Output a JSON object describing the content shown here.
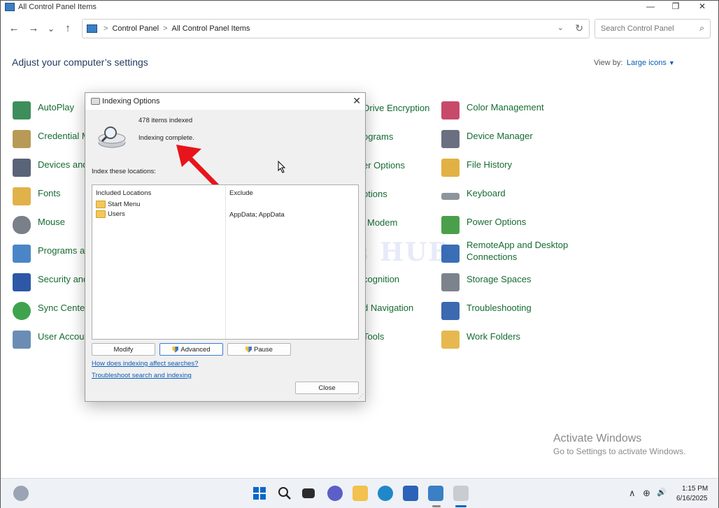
{
  "window": {
    "title": "All Control Panel Items",
    "minimize": "—",
    "maximize": "❐",
    "close": "✕"
  },
  "nav": {
    "back": "←",
    "forward": "→",
    "recent": "⌄",
    "up": "↑",
    "breadcrumb": [
      "Control Panel",
      "All Control Panel Items"
    ],
    "sep": ">",
    "dropdown": "⌄",
    "refresh": "↻",
    "search_placeholder": "Search Control Panel",
    "search_icon": "⌕"
  },
  "header": {
    "title": "Adjust your computer’s settings",
    "view_by_label": "View by:",
    "view_by_value": "Large icons",
    "view_by_caret": "▼"
  },
  "items": {
    "col1": [
      {
        "label": "AutoPlay",
        "icon": "autoplay-icon",
        "color": "#3e8e5c"
      },
      {
        "label": "Credential M",
        "icon": "credential-manager-icon",
        "color": "#b89a57"
      },
      {
        "label": "Devices and",
        "icon": "devices-printers-icon",
        "color": "#5a6478"
      },
      {
        "label": "Fonts",
        "icon": "fonts-icon",
        "color": "#e1b24a"
      },
      {
        "label": "Mouse",
        "icon": "mouse-icon",
        "color": "#7a8089"
      },
      {
        "label": "Programs an",
        "icon": "programs-features-icon",
        "color": "#4a86c7"
      },
      {
        "label": "Security and",
        "icon": "security-maintenance-icon",
        "color": "#2c58a6"
      },
      {
        "label": "Sync Center",
        "icon": "sync-center-icon",
        "color": "#3fa34d"
      },
      {
        "label": "User Accour",
        "icon": "user-accounts-icon",
        "color": "#6b8db5"
      }
    ],
    "col2": [
      {
        "label": "Drive Encryption",
        "icon": "",
        "color": ""
      },
      {
        "label": "ograms",
        "icon": "",
        "color": ""
      },
      {
        "label": "er Options",
        "icon": "",
        "color": ""
      },
      {
        "label": "ptions",
        "icon": "",
        "color": ""
      },
      {
        "label": "Modem",
        "icon": "",
        "color": ""
      },
      {
        "label": "",
        "icon": "",
        "color": ""
      },
      {
        "label": "cognition",
        "icon": "",
        "color": ""
      },
      {
        "label": "d Navigation",
        "icon": "",
        "color": ""
      },
      {
        "label": "Tools",
        "icon": "",
        "color": ""
      }
    ],
    "col3": [
      {
        "label": "Color Management",
        "icon": "color-management-icon",
        "color": "#c84a6a"
      },
      {
        "label": "Device Manager",
        "icon": "device-manager-icon",
        "color": "#6a7080"
      },
      {
        "label": "File History",
        "icon": "file-history-icon",
        "color": "#e2b143"
      },
      {
        "label": "Keyboard",
        "icon": "keyboard-icon",
        "color": "#8e949c"
      },
      {
        "label": "Power Options",
        "icon": "power-options-icon",
        "color": "#4aa04a"
      },
      {
        "label": "RemoteApp and Desktop Connections",
        "label2": "Connections",
        "label1": "RemoteApp and Desktop",
        "icon": "remoteapp-icon",
        "color": "#3a6fb5"
      },
      {
        "label": "Storage Spaces",
        "icon": "storage-spaces-icon",
        "color": "#7d838c"
      },
      {
        "label": "Troubleshooting",
        "icon": "troubleshooting-icon",
        "color": "#3c69b0"
      },
      {
        "label": "Work Folders",
        "icon": "work-folders-icon",
        "color": "#e6b84f"
      }
    ]
  },
  "watermark": "IT Pros HUB",
  "activation": {
    "line1": "Activate Windows",
    "line2": "Go to Settings to activate Windows."
  },
  "dialog": {
    "title": "Indexing Options",
    "close": "✕",
    "items_indexed": "478 items indexed",
    "status": "Indexing complete.",
    "locations_label": "Index these locations:",
    "included_header": "Included Locations",
    "exclude_header": "Exclude",
    "locations": [
      {
        "name": "Start Menu",
        "exclude": ""
      },
      {
        "name": "Users",
        "exclude": "AppData; AppData"
      }
    ],
    "modify": "Modify",
    "advanced": "Advanced",
    "pause": "Pause",
    "link_affect": "How does indexing affect searches?",
    "link_troubleshoot": "Troubleshoot search and indexing",
    "close_button": "Close",
    "arrow_color": "#e8141b"
  },
  "taskbar": {
    "time": "1:15 PM",
    "date": "6/16/2025",
    "chevron": "∧",
    "network": "⊕",
    "volume": "🔊",
    "accent": "#0067c0"
  }
}
